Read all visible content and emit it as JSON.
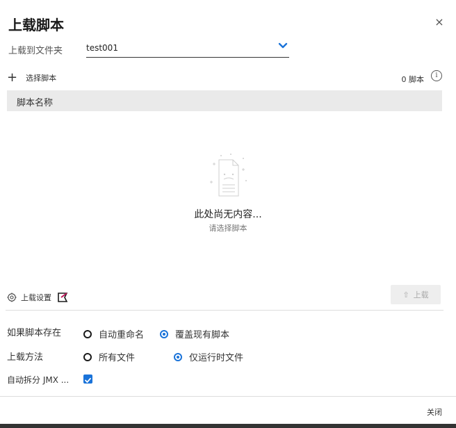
{
  "dialog": {
    "title": "上载脚本",
    "close_symbol": "×"
  },
  "folder": {
    "label": "上载到文件夹",
    "value": "test001"
  },
  "scripts": {
    "add_symbol": "+",
    "add_label": "选择脚本",
    "count_label": "0 脚本",
    "info_symbol": "i",
    "column_header": "脚本名称"
  },
  "empty_state": {
    "title": "此处尚无内容...",
    "subtitle": "请选择脚本"
  },
  "settings": {
    "label": "上载设置",
    "upload_icon_symbol": "⇧",
    "upload_button": "上载"
  },
  "options": {
    "if_exists_label": "如果脚本存在",
    "if_exists_choices": [
      {
        "label": "自动重命名",
        "selected": false
      },
      {
        "label": "覆盖现有脚本",
        "selected": true
      }
    ],
    "upload_method_label": "上载方法",
    "upload_method_choices": [
      {
        "label": "所有文件",
        "selected": false
      },
      {
        "label": "仅运行时文件",
        "selected": true
      }
    ],
    "auto_split_label": "自动拆分 JMX ...",
    "auto_split_checked": true
  },
  "footer": {
    "close_label": "关闭"
  },
  "colors": {
    "accent": "#1a73d9",
    "header_bg": "#eaeaea",
    "flag_pink": "#c2185b"
  },
  "icons": {
    "close": "close-icon",
    "chevron": "chevron-down-icon",
    "plus": "plus-icon",
    "info": "info-icon",
    "gear": "gear-icon",
    "flag": "flag-icon",
    "upload": "upload-icon",
    "empty": "empty-document-icon",
    "check": "checkmark-icon"
  }
}
